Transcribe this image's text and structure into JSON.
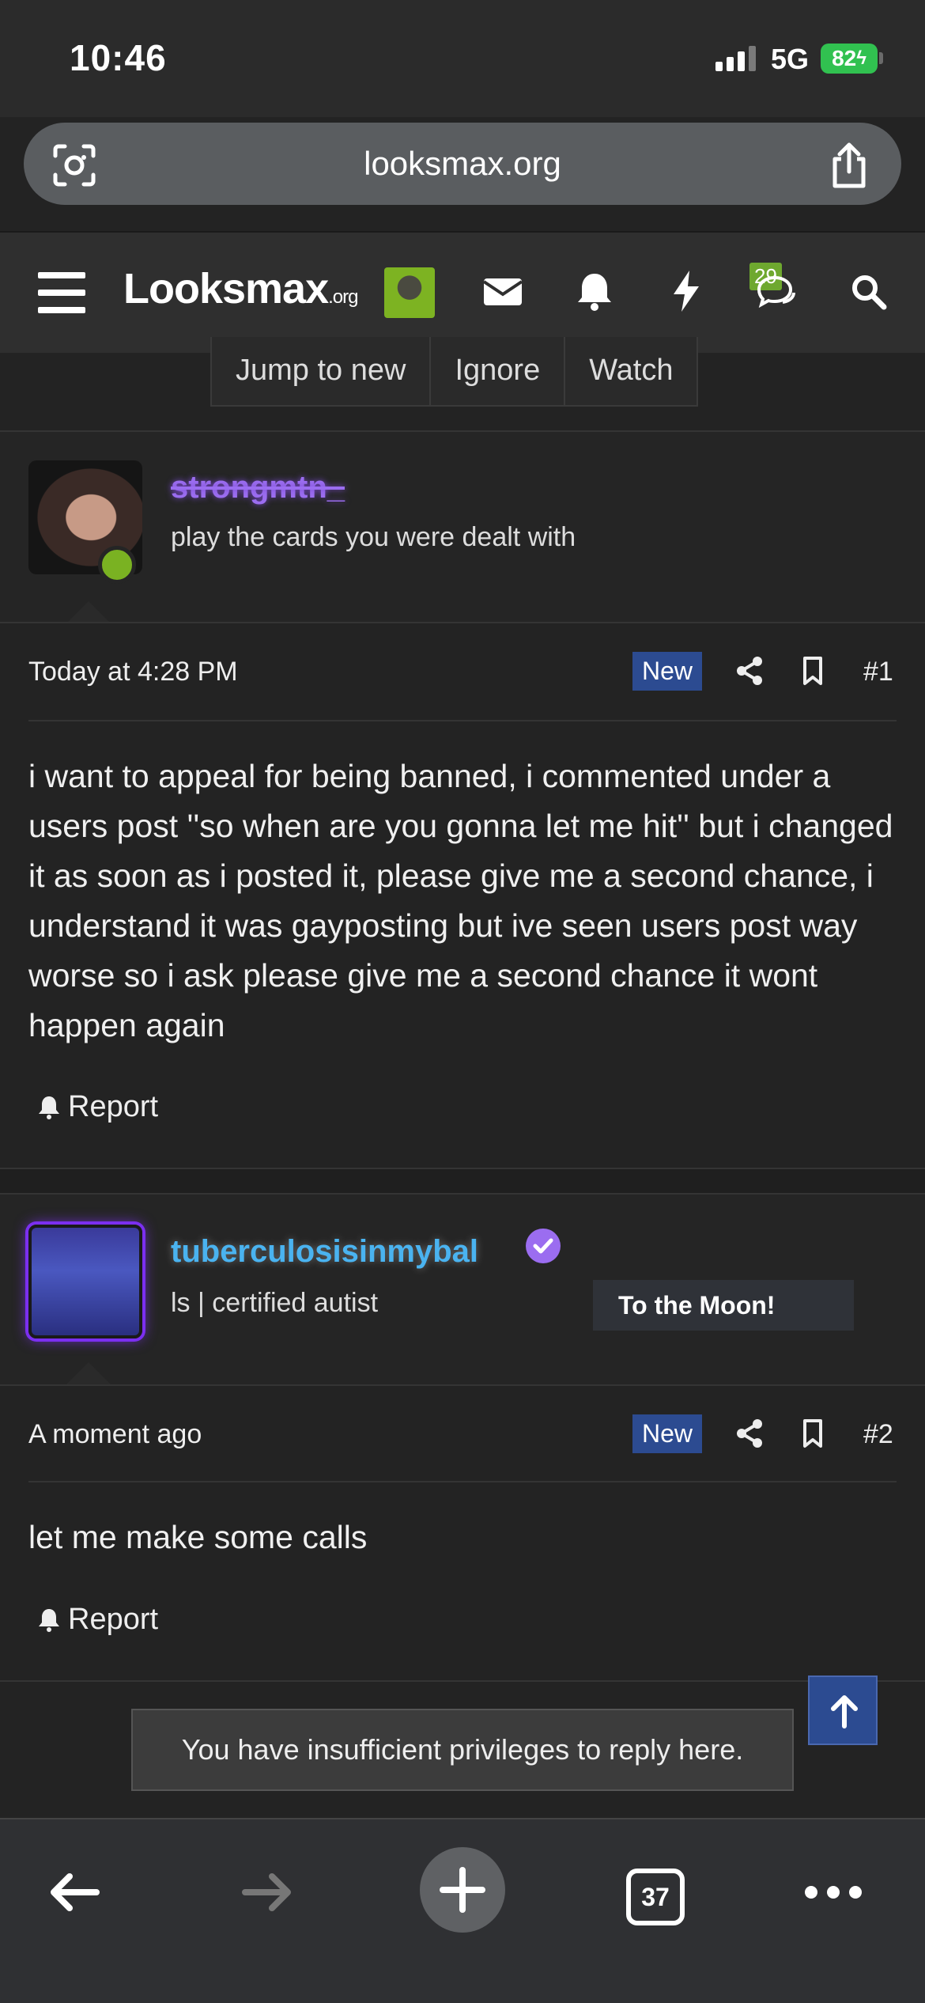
{
  "status_bar": {
    "time": "10:46",
    "network": "5G",
    "battery": "82"
  },
  "browser": {
    "url": "looksmax.org",
    "tab_count": "37"
  },
  "site": {
    "logo_main": "Looksmax",
    "logo_suffix": ".org",
    "conversations_badge": "29"
  },
  "thread_buttons": [
    "Jump to new",
    "Ignore",
    "Watch"
  ],
  "posts": [
    {
      "username": "strongmtn_",
      "user_title": "play the cards you were dealt with",
      "timestamp": "Today at 4:28 PM",
      "badge": "New",
      "number": "#1",
      "body": "i want to appeal for being banned, i commented under a users post ''so when are you gonna let me hit'' but i changed it as soon as i posted it, please give me a second chance, i understand it was gayposting but ive seen users post way worse so i ask please give me a second chance it wont happen again",
      "report_label": "Report"
    },
    {
      "username": "tuberculosisinmybal",
      "user_title": "ls | certified autist",
      "banner": "To the Moon!",
      "timestamp": "A moment ago",
      "badge": "New",
      "number": "#2",
      "body": "let me make some calls",
      "report_label": "Report"
    }
  ],
  "footer_notice": "You have insufficient privileges to reply here.",
  "colors": {
    "accent_blue": "#2c4b91",
    "online_green": "#7ab222",
    "purple_name": "#9b6df0",
    "blue_name": "#4ab3f0"
  }
}
